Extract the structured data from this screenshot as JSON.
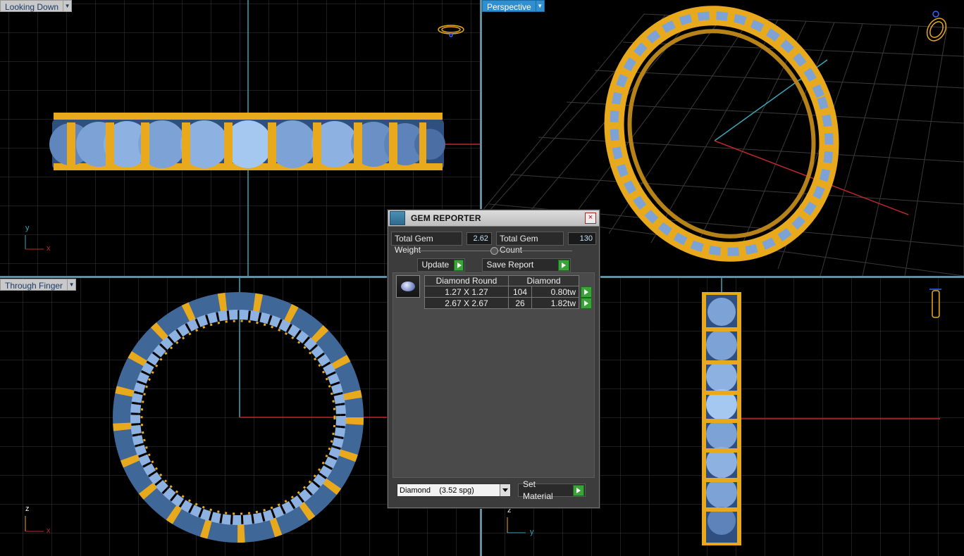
{
  "viewports": {
    "top_left": {
      "label": "Looking Down",
      "axis_a": "y",
      "axis_b": "x"
    },
    "top_right": {
      "label": "Perspective"
    },
    "bottom_left": {
      "label": "Through Finger",
      "axis_a": "z",
      "axis_b": "x"
    },
    "bottom_right": {
      "axis_a": "z",
      "axis_b": "y"
    }
  },
  "gem_reporter": {
    "title": "GEM REPORTER",
    "close_glyph": "×",
    "total_weight_label": "Total Gem Weight",
    "total_weight_value": "2.62",
    "total_count_label": "Total Gem Count",
    "total_count_value": "130",
    "update_label": "Update",
    "save_report_label": "Save Report",
    "table": {
      "headers": [
        "Diamond Round",
        "Diamond"
      ],
      "rows": [
        {
          "size": "1.27 X 1.27",
          "count": "104",
          "weight": "0.80tw"
        },
        {
          "size": "2.67 X 2.67",
          "count": "26",
          "weight": "1.82tw"
        }
      ]
    },
    "material_select": "Diamond    (3.52 spg)",
    "set_material_label": "Set Material"
  },
  "colors": {
    "gold": "#e8a91d",
    "gem": "#7da3d6",
    "grid": "#3a3a3a",
    "axis_red": "#c0272d",
    "axis_cyan": "#3aa6b8",
    "active_tab": "#2f8fd0"
  }
}
